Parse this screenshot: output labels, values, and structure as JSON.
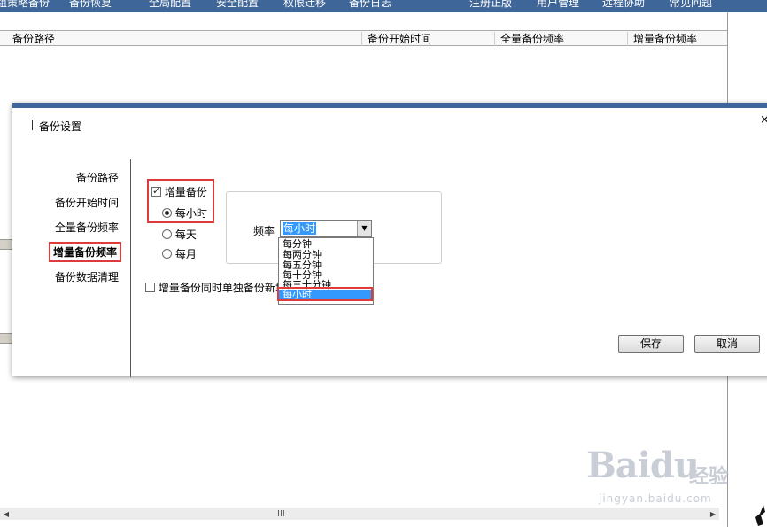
{
  "topnav": {
    "items": [
      "组策略备份",
      "备份恢复",
      "全局配置",
      "安全配置",
      "权限迁移",
      "备份日志",
      "注册正版",
      "用户管理",
      "远程协助",
      "常见问题"
    ]
  },
  "background": {
    "columns": [
      "备份路径",
      "备份开始时间",
      "全量备份频率",
      "增量备份频率"
    ],
    "scroll_grip": "III"
  },
  "dialog": {
    "title": "备份设置",
    "close": "×",
    "nav": [
      "备份路径",
      "备份开始时间",
      "全量备份频率",
      "增量备份频率",
      "备份数据清理"
    ],
    "active_nav": "增量备份频率",
    "incremental_label": "增量备份",
    "incremental_checked": true,
    "radios": [
      "每小时",
      "每天",
      "每月"
    ],
    "selected_radio": "每小时",
    "separate_backup_label": "增量备份同时单独备份新增",
    "separate_backup_checked": false,
    "frequency_label": "频率",
    "frequency_value": "每小时",
    "frequency_options": [
      "每分钟",
      "每两分钟",
      "每五分钟",
      "每十分钟",
      "每三十分钟",
      "每小时"
    ],
    "save_label": "保存",
    "cancel_label": "取消"
  },
  "watermark": {
    "logo": "Baidu",
    "logo_cn": "经验",
    "url": "jingyan.baidu.com"
  },
  "colors": {
    "header_blue": "#3f6699",
    "highlight_red": "#e03b3b",
    "selection_blue": "#3399ff"
  }
}
